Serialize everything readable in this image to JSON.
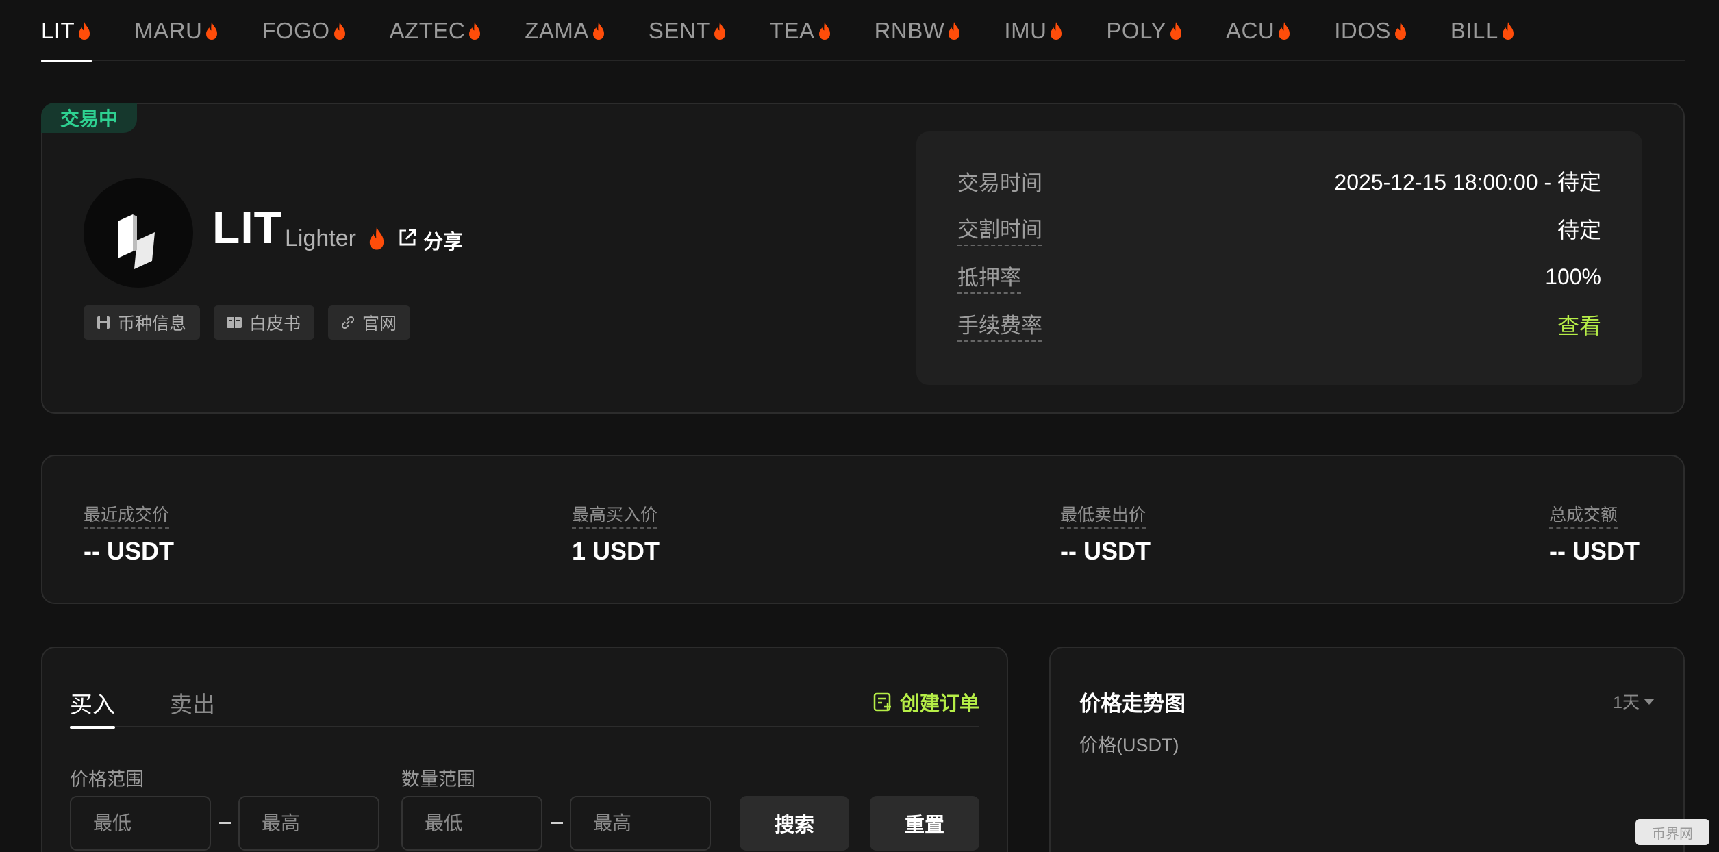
{
  "tabs": [
    {
      "label": "LIT",
      "active": true
    },
    {
      "label": "MARU"
    },
    {
      "label": "FOGO"
    },
    {
      "label": "AZTEC"
    },
    {
      "label": "ZAMA"
    },
    {
      "label": "SENT"
    },
    {
      "label": "TEA"
    },
    {
      "label": "RNBW"
    },
    {
      "label": "IMU"
    },
    {
      "label": "POLY"
    },
    {
      "label": "ACU"
    },
    {
      "label": "IDOS"
    },
    {
      "label": "BILL"
    }
  ],
  "colors": {
    "accent": "#b6ee47",
    "status_green": "#2ed191",
    "flame": "#ff4d0a"
  },
  "hero": {
    "status": "交易中",
    "symbol": "LIT",
    "name": "Lighter",
    "share": "分享",
    "links": [
      {
        "label": "币种信息",
        "icon": "save-icon"
      },
      {
        "label": "白皮书",
        "icon": "book-icon"
      },
      {
        "label": "官网",
        "icon": "link-icon"
      }
    ],
    "details": {
      "trade_time_label": "交易时间",
      "trade_time_value": "2025-12-15 18:00:00 - 待定",
      "delivery_time_label": "交割时间",
      "delivery_time_value": "待定",
      "collateral_label": "抵押率",
      "collateral_value": "100%",
      "fee_label": "手续费率",
      "fee_value": "查看"
    }
  },
  "stats": {
    "last_price_label": "最近成交价",
    "last_price_value": "-- USDT",
    "best_bid_label": "最高买入价",
    "best_bid_value": "1 USDT",
    "best_ask_label": "最低卖出价",
    "best_ask_value": "-- USDT",
    "volume_label": "总成交额",
    "volume_value": "-- USDT"
  },
  "order": {
    "buy_tab": "买入",
    "sell_tab": "卖出",
    "create_order": "创建订单",
    "price_range_label": "价格范围",
    "qty_range_label": "数量范围",
    "min_placeholder": "最低",
    "max_placeholder": "最高",
    "search": "搜索",
    "reset": "重置"
  },
  "chart": {
    "title": "价格走势图",
    "period": "1天",
    "unit": "价格(USDT)"
  },
  "watermark": "币界网"
}
